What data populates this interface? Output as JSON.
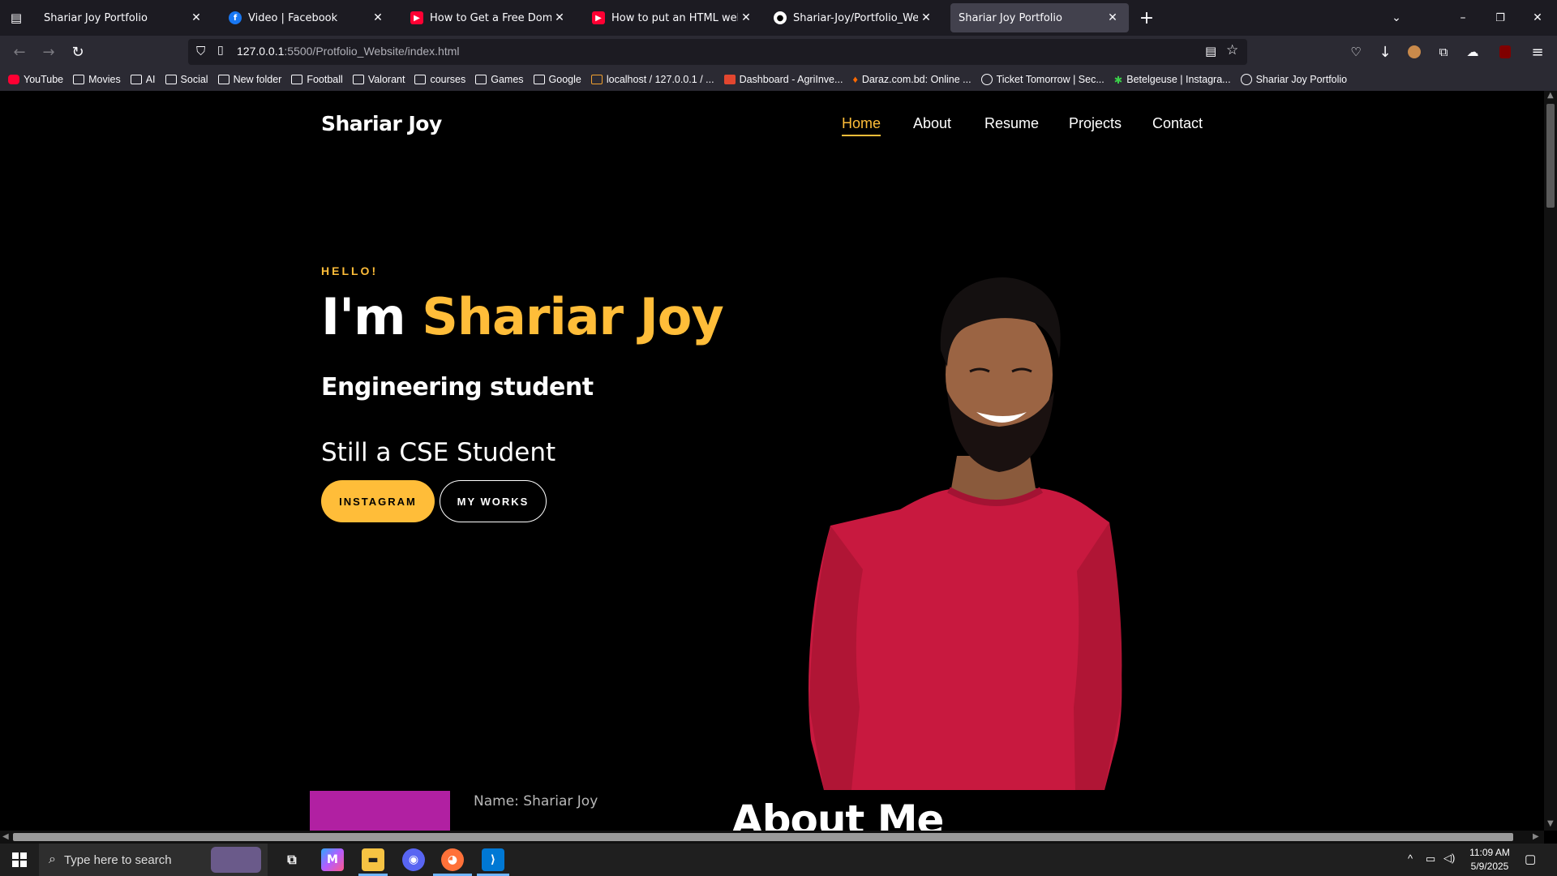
{
  "browser": {
    "tabs": [
      {
        "title": "Shariar Joy Portfolio",
        "favicon": "none"
      },
      {
        "title": "Video | Facebook",
        "favicon": "facebook-icon"
      },
      {
        "title": "How to Get a Free Domain (Com",
        "favicon": "youtube-icon"
      },
      {
        "title": "How to put an HTML website o",
        "favicon": "youtube-icon"
      },
      {
        "title": "Shariar-Joy/Portfolio_Website-m",
        "favicon": "github-icon"
      },
      {
        "title": "Shariar Joy Portfolio",
        "favicon": "none"
      }
    ],
    "url": {
      "host": "127.0.0.1",
      "path": ":5500/Protfolio_Website/index.html"
    },
    "bookmarks": [
      {
        "label": "YouTube",
        "icon": "youtube-icon"
      },
      {
        "label": "Movies",
        "icon": "folder-icon"
      },
      {
        "label": "AI",
        "icon": "folder-icon"
      },
      {
        "label": "Social",
        "icon": "folder-icon"
      },
      {
        "label": "New folder",
        "icon": "folder-icon"
      },
      {
        "label": "Football",
        "icon": "folder-icon"
      },
      {
        "label": "Valorant",
        "icon": "folder-icon"
      },
      {
        "label": "courses",
        "icon": "folder-icon"
      },
      {
        "label": "Games",
        "icon": "folder-icon"
      },
      {
        "label": "Google",
        "icon": "folder-icon"
      },
      {
        "label": "localhost / 127.0.0.1 / ...",
        "icon": "phpmyadmin-icon"
      },
      {
        "label": "Dashboard - AgriInve...",
        "icon": "app-icon"
      },
      {
        "label": "Daraz.com.bd: Online ...",
        "icon": "flame-icon"
      },
      {
        "label": "Ticket Tomorrow | Sec...",
        "icon": "globe-icon"
      },
      {
        "label": "Betelgeuse | Instagra...",
        "icon": "star-icon"
      },
      {
        "label": "Shariar Joy Portfolio",
        "icon": "globe-icon"
      }
    ]
  },
  "site": {
    "logo": "Shariar Joy",
    "menu": [
      "Home",
      "About",
      "Resume",
      "Projects",
      "Contact"
    ],
    "hero": {
      "greeting": "HELLO!",
      "prefix": "I'm ",
      "name": "Shariar Joy",
      "subtitle": "Engineering student",
      "typed": "Still a CSE Student",
      "btn_primary": "INSTAGRAM",
      "btn_secondary": "MY WORKS"
    },
    "about": {
      "name_line": "Name: Shariar Joy",
      "title": "About Me"
    },
    "colors": {
      "accent": "#ffbd39",
      "shirt": "#c8193f",
      "about_photo": "#b120a2"
    }
  },
  "taskbar": {
    "search_placeholder": "Type here to search",
    "time": "11:09 AM",
    "date": "5/9/2025"
  }
}
